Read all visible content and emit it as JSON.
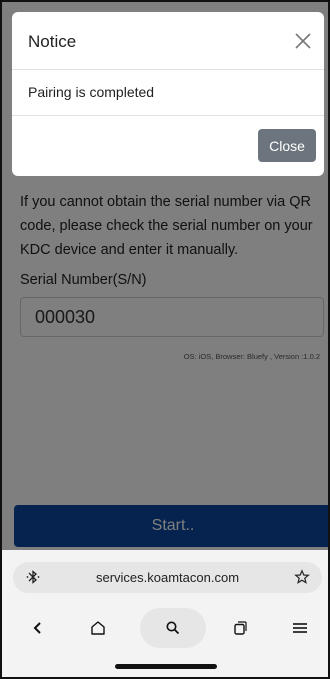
{
  "page": {
    "help_text": "If you cannot obtain the serial number via QR code, please check the serial number on your KDC device and enter it manually.",
    "serial_label": "Serial Number(S/N)",
    "serial_value": "000030",
    "env_info": "OS: iOS, Browser: Bluefy , Version :1.0.2",
    "start_label": "Start..",
    "accent_color": "#0d47a1"
  },
  "modal": {
    "title": "Notice",
    "message": "Pairing is completed",
    "close_label": "Close"
  },
  "browser": {
    "url": "services.koamtacon.com",
    "icons": [
      "bluetooth-icon",
      "star-icon",
      "back-icon",
      "home-icon",
      "search-icon",
      "tabs-icon",
      "menu-icon"
    ]
  }
}
